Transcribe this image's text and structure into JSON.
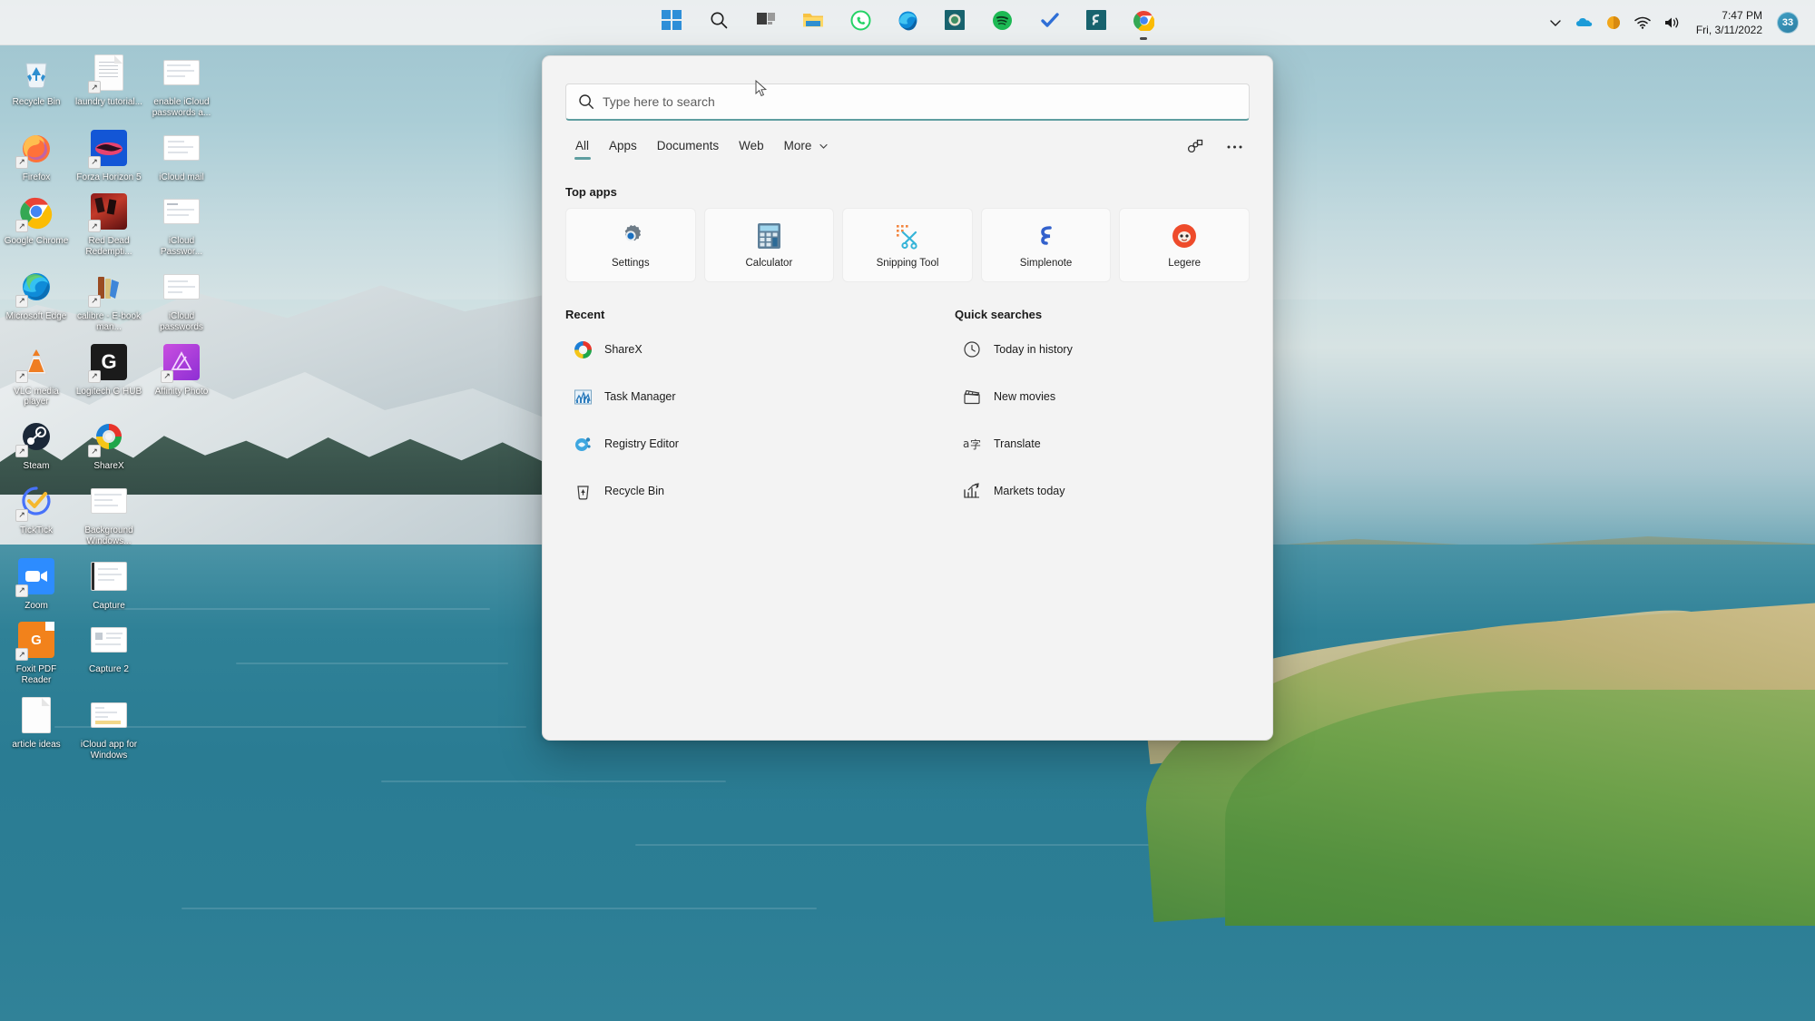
{
  "taskbar": {
    "buttons": [
      {
        "name": "start",
        "label": "Start",
        "icon": "windows-logo-icon"
      },
      {
        "name": "search",
        "label": "Search",
        "icon": "search-icon"
      },
      {
        "name": "task-view",
        "label": "Task View",
        "icon": "task-view-icon"
      },
      {
        "name": "file-explorer",
        "label": "File Explorer",
        "icon": "folder-icon"
      },
      {
        "name": "whatsapp",
        "label": "WhatsApp",
        "icon": "whatsapp-icon"
      },
      {
        "name": "edge",
        "label": "Microsoft Edge",
        "icon": "edge-icon"
      },
      {
        "name": "legere",
        "label": "Legere",
        "icon": "legere-icon"
      },
      {
        "name": "spotify",
        "label": "Spotify",
        "icon": "spotify-icon"
      },
      {
        "name": "ticktick",
        "label": "TickTick",
        "icon": "checkmark-icon"
      },
      {
        "name": "simplenote",
        "label": "Simplenote",
        "icon": "simplenote-icon"
      },
      {
        "name": "chrome",
        "label": "Google Chrome",
        "icon": "chrome-icon"
      }
    ],
    "tray": {
      "overflow": "show-hidden-icons",
      "icons": [
        "onedrive-icon",
        "battery-icon",
        "wifi-icon",
        "volume-icon"
      ],
      "time": "7:47 PM",
      "date": "Fri, 3/11/2022",
      "badge": "33"
    }
  },
  "desktop": {
    "icons": [
      {
        "label": "Recycle Bin",
        "icon": "recycle-bin-icon",
        "shortcut": false
      },
      {
        "label": "laundry tutorial...",
        "icon": "document-icon",
        "shortcut": true
      },
      {
        "label": "enable iCloud passwords a...",
        "icon": "screenshot-icon",
        "shortcut": false
      },
      {
        "label": "Firefox",
        "icon": "firefox-icon",
        "shortcut": true
      },
      {
        "label": "Forza Horizon 5",
        "icon": "forza-horizon-icon",
        "shortcut": true
      },
      {
        "label": "iCloud mail",
        "icon": "screenshot-icon",
        "shortcut": false
      },
      {
        "label": "Google Chrome",
        "icon": "chrome-icon",
        "shortcut": true
      },
      {
        "label": "Red Dead Redempti...",
        "icon": "red-dead-icon",
        "shortcut": true
      },
      {
        "label": "iCloud Passwor...",
        "icon": "screenshot-icon",
        "shortcut": false
      },
      {
        "label": "Microsoft Edge",
        "icon": "edge-icon",
        "shortcut": true
      },
      {
        "label": "calibre - E-book man...",
        "icon": "calibre-icon",
        "shortcut": true
      },
      {
        "label": "iCloud passwords",
        "icon": "screenshot-icon",
        "shortcut": false
      },
      {
        "label": "VLC media player",
        "icon": "vlc-icon",
        "shortcut": true
      },
      {
        "label": "Logitech G HUB",
        "icon": "logitech-g-icon",
        "shortcut": true
      },
      {
        "label": "Affinity Photo",
        "icon": "affinity-photo-icon",
        "shortcut": true
      },
      {
        "label": "Steam",
        "icon": "steam-icon",
        "shortcut": true
      },
      {
        "label": "ShareX",
        "icon": "sharex-icon",
        "shortcut": true
      },
      {
        "label": "TickTick",
        "icon": "ticktick-icon",
        "shortcut": true
      },
      {
        "label": "Background Windows...",
        "icon": "screenshot-icon",
        "shortcut": false
      },
      {
        "label": "Zoom",
        "icon": "zoom-icon",
        "shortcut": true
      },
      {
        "label": "Capture",
        "icon": "screenshot-icon",
        "shortcut": false
      },
      {
        "label": "Foxit PDF Reader",
        "icon": "foxit-pdf-icon",
        "shortcut": true
      },
      {
        "label": "Capture 2",
        "icon": "screenshot-icon",
        "shortcut": false
      },
      {
        "label": "article ideas",
        "icon": "document-icon",
        "shortcut": false
      },
      {
        "label": "iCloud app for Windows",
        "icon": "screenshot-icon",
        "shortcut": false
      }
    ]
  },
  "search_panel": {
    "input": {
      "value": "",
      "placeholder": "Type here to search",
      "icon": "search-icon",
      "accent_color": "#5f9ea0"
    },
    "tabs": [
      {
        "label": "All",
        "active": true
      },
      {
        "label": "Apps",
        "active": false
      },
      {
        "label": "Documents",
        "active": false
      },
      {
        "label": "Web",
        "active": false
      },
      {
        "label": "More",
        "active": false,
        "chevron": "⌄"
      }
    ],
    "tab_actions": [
      {
        "name": "account-icon",
        "glyph": "⛭"
      },
      {
        "name": "more-options-icon",
        "glyph": "···"
      }
    ],
    "top_apps": {
      "title": "Top apps",
      "items": [
        {
          "label": "Settings",
          "icon": "settings-gear-icon"
        },
        {
          "label": "Calculator",
          "icon": "calculator-icon"
        },
        {
          "label": "Snipping Tool",
          "icon": "snipping-tool-icon"
        },
        {
          "label": "Simplenote",
          "icon": "simplenote-icon"
        },
        {
          "label": "Legere",
          "icon": "legere-icon"
        }
      ]
    },
    "recent": {
      "title": "Recent",
      "items": [
        {
          "label": "ShareX",
          "icon": "sharex-icon"
        },
        {
          "label": "Task Manager",
          "icon": "task-manager-icon"
        },
        {
          "label": "Registry Editor",
          "icon": "registry-editor-icon"
        },
        {
          "label": "Recycle Bin",
          "icon": "recycle-bin-icon"
        }
      ]
    },
    "quick_searches": {
      "title": "Quick searches",
      "items": [
        {
          "label": "Today in history",
          "icon": "clock-icon"
        },
        {
          "label": "New movies",
          "icon": "clapperboard-icon"
        },
        {
          "label": "Translate",
          "icon": "translate-icon"
        },
        {
          "label": "Markets today",
          "icon": "trending-up-icon"
        }
      ]
    }
  }
}
